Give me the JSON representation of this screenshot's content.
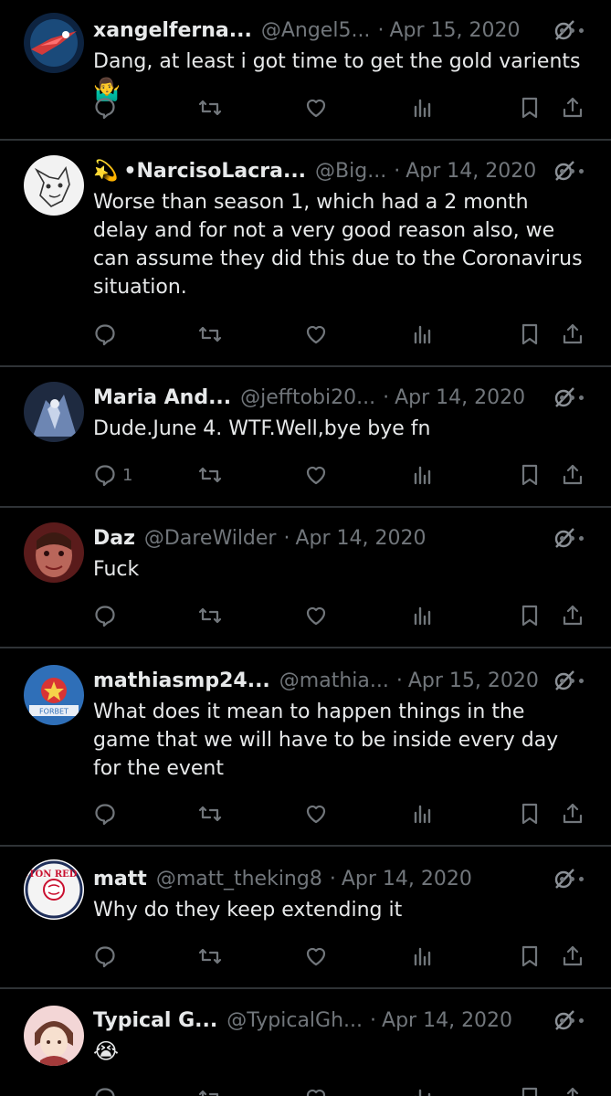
{
  "tweets": [
    {
      "name": "xangelferna...",
      "handle": "@Angel5...",
      "date": "Apr 15, 2020",
      "prefix": "",
      "text": "Dang, at least i got time to get the gold varients",
      "emoji": "🤷‍♂️",
      "reply_count": ""
    },
    {
      "name": "•NarcisoLacra...",
      "handle": "@Big...",
      "date": "Apr 14, 2020",
      "prefix": "💫",
      "text": "Worse than season 1, which had a 2 month delay and for not a very good reason also, we can assume they did this due to the Coronavirus situation.",
      "emoji": "",
      "reply_count": ""
    },
    {
      "name": "Maria And...",
      "handle": "@jefftobi20...",
      "date": "Apr 14, 2020",
      "prefix": "",
      "text": "Dude.June 4. WTF.Well,bye bye fn",
      "emoji": "",
      "reply_count": "1"
    },
    {
      "name": "Daz",
      "handle": "@DareWilder",
      "date": "Apr 14, 2020",
      "prefix": "",
      "text": "Fuck",
      "emoji": "",
      "reply_count": ""
    },
    {
      "name": "mathiasmp24...",
      "handle": "@mathia...",
      "date": "Apr 15, 2020",
      "prefix": "",
      "text": "What does it mean to happen things in the game that we will have to be inside every day for the event",
      "emoji": "",
      "reply_count": ""
    },
    {
      "name": "matt",
      "handle": "@matt_theking8",
      "date": "Apr 14, 2020",
      "prefix": "",
      "text": "Why do they keep extending it",
      "emoji": "",
      "reply_count": ""
    },
    {
      "name": "Typical G...",
      "handle": "@TypicalGh...",
      "date": "Apr 14, 2020",
      "prefix": "",
      "text": "",
      "emoji": "😭",
      "reply_count": ""
    }
  ],
  "separator": "·",
  "icons": [
    "reply-icon",
    "retweet-icon",
    "like-icon",
    "views-icon",
    "bookmark-icon",
    "share-icon",
    "grok-icon",
    "more-icon"
  ],
  "colors": {
    "background": "#000000",
    "text": "#e7e9ea",
    "muted": "#71767b",
    "divider": "#2f3336"
  },
  "avatar_avatar5_text": "FORBET",
  "avatar_avatar6_text": "BOSTON RED SOX"
}
